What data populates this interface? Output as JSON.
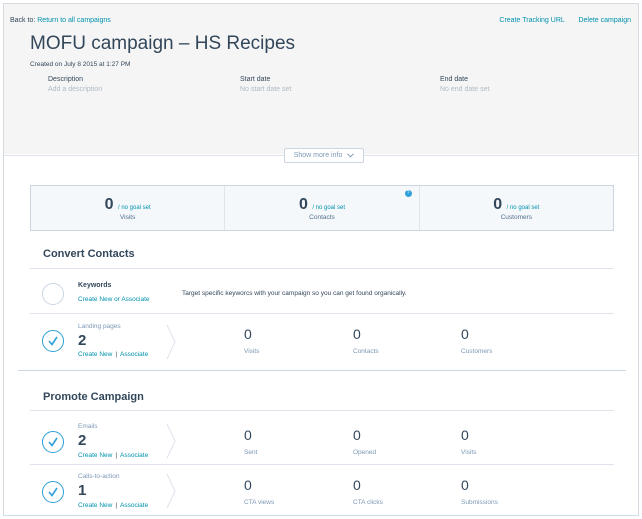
{
  "header": {
    "back_prefix": "Back to:",
    "back_link": "Return to all campaigns",
    "create_tracking": "Create Tracking URL",
    "delete_campaign": "Delete campaign",
    "title": "MOFU campaign – HS Recipes",
    "created": "Created on July 8 2015 at 1:27 PM",
    "description_label": "Description",
    "description_value": "Add a description",
    "start_label": "Start date",
    "start_value": "No start date set",
    "end_label": "End date",
    "end_value": "No end date set",
    "show_more": "Show more info"
  },
  "stats": [
    {
      "num": "0",
      "goal": "/ no goal set",
      "label": "Visits"
    },
    {
      "num": "0",
      "goal": "/ no goal set",
      "label": "Contacts",
      "info": "?"
    },
    {
      "num": "0",
      "goal": "/ no goal set",
      "label": "Customers"
    }
  ],
  "convert": {
    "title": "Convert Contacts",
    "keywords": {
      "title": "Keywords",
      "links": "Create New or Associate",
      "text": "Target specific keyworcs with your campaign so you can get found organically."
    },
    "landing": {
      "label": "Landing pages",
      "count": "2",
      "create": "Create New",
      "sep": "|",
      "associate": "Associate",
      "metrics": [
        {
          "value": "0",
          "label": "Visits"
        },
        {
          "value": "0",
          "label": "Contacts"
        },
        {
          "value": "0",
          "label": "Customers"
        }
      ]
    }
  },
  "promote": {
    "title": "Promote Campaign",
    "emails": {
      "label": "Emails",
      "count": "2",
      "create": "Create New",
      "sep": "|",
      "associate": "Associate",
      "metrics": [
        {
          "value": "0",
          "label": "Sent"
        },
        {
          "value": "0",
          "label": "Opened"
        },
        {
          "value": "0",
          "label": "Visits"
        }
      ]
    },
    "ctas": {
      "label": "Calls-to-action",
      "count": "1",
      "create": "Create New",
      "sep": "|",
      "associate": "Associate",
      "metrics": [
        {
          "value": "0",
          "label": "CTA views"
        },
        {
          "value": "0",
          "label": "CTA clicks"
        },
        {
          "value": "0",
          "label": "Submissions"
        }
      ]
    }
  },
  "colors": {
    "link": "#0091ae",
    "check": "#2d9fd9",
    "text": "#33475b"
  },
  "icons": [
    "check-icon",
    "chevron-down-icon",
    "chevron-right-icon",
    "info-icon"
  ]
}
